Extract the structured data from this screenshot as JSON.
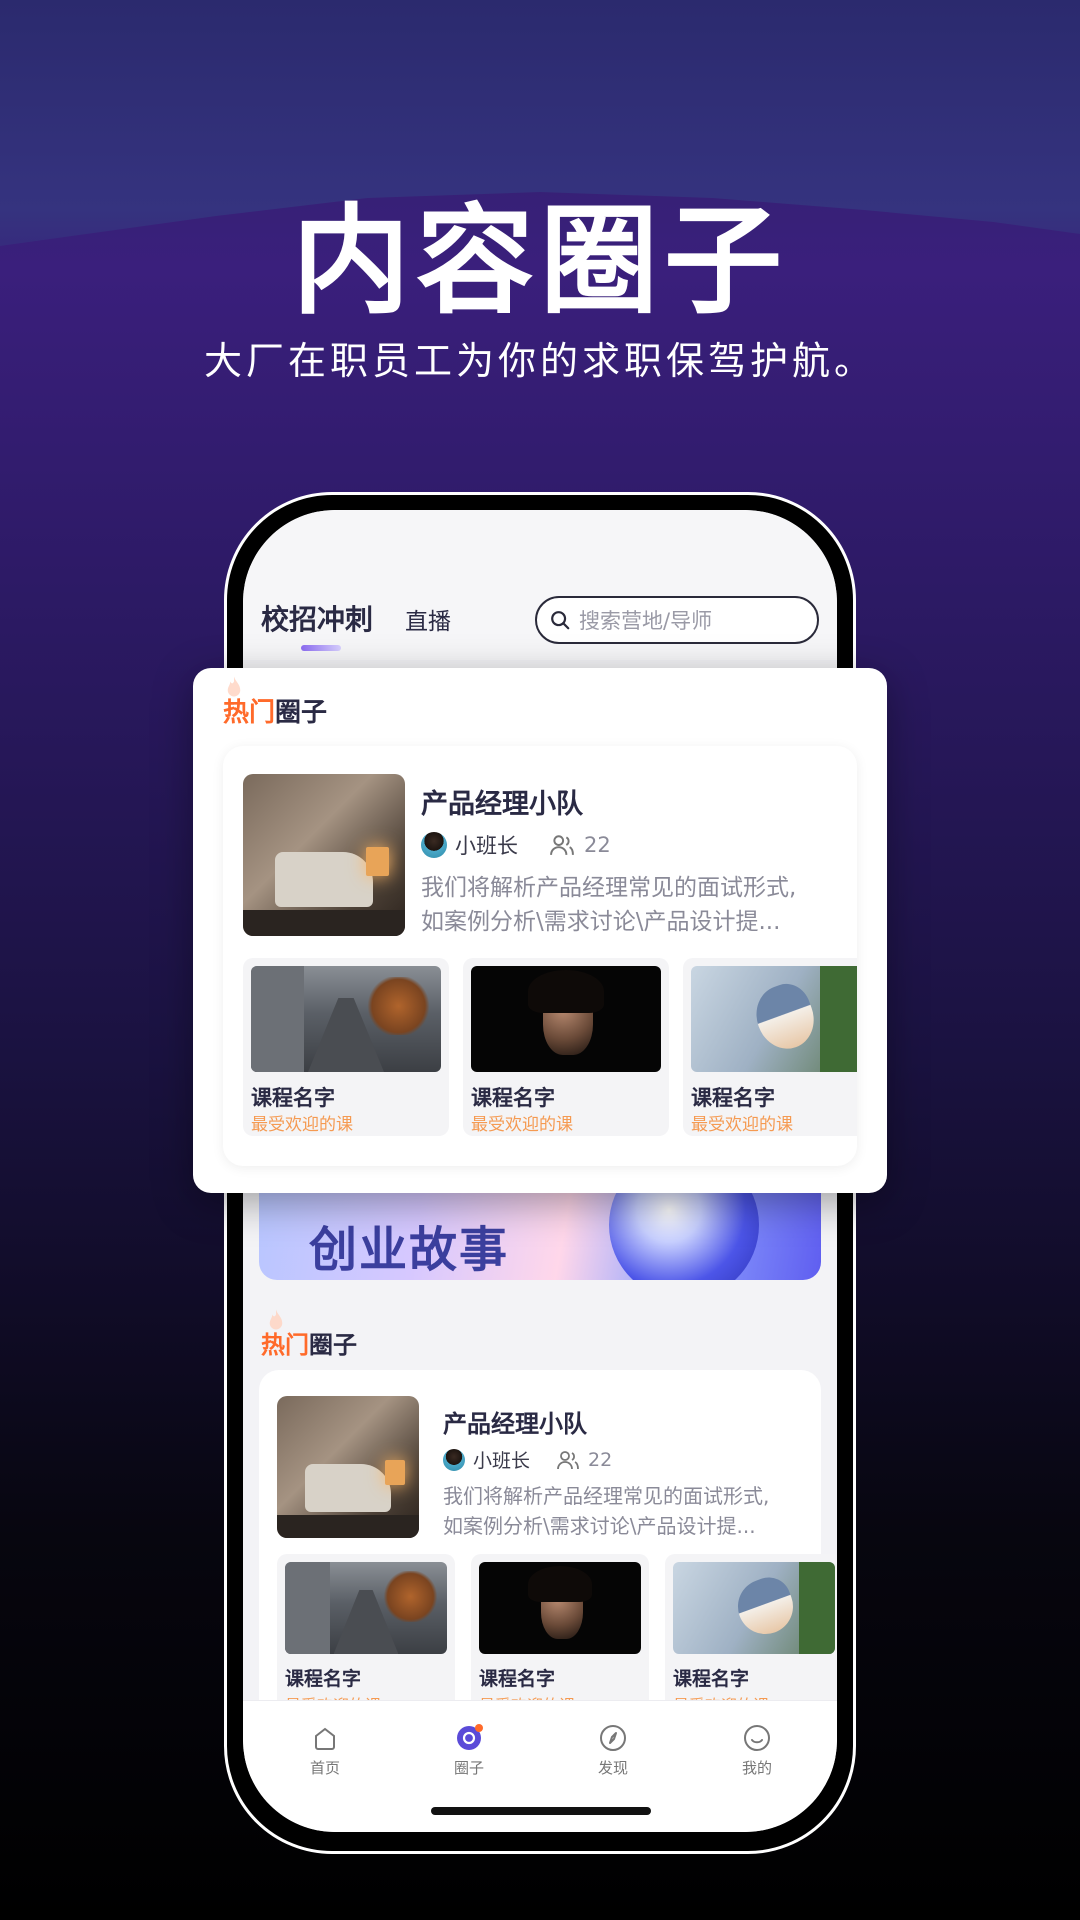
{
  "hero": {
    "title": "内容圈子",
    "subtitle": "大厂在职员工为你的求职保驾护航。"
  },
  "header": {
    "tab_active": "校招冲刺",
    "tab_live": "直播",
    "search_placeholder": "搜索营地/导师"
  },
  "banner": {
    "text": "创业故事"
  },
  "section": {
    "hot": "热门",
    "circle": "圈子"
  },
  "circle": {
    "name": "产品经理小队",
    "owner": "小班长",
    "members": "22",
    "desc_line1": "我们将解析产品经理常见的面试形式,",
    "desc_line2": "如案例分析\\需求讨论\\产品设计提..."
  },
  "courses": [
    {
      "name": "课程名字",
      "tag": "最受欢迎的课"
    },
    {
      "name": "课程名字",
      "tag": "最受欢迎的课"
    },
    {
      "name": "课程名字",
      "tag": "最受欢迎的课"
    }
  ],
  "nav": {
    "home": "首页",
    "circle": "圈子",
    "discover": "发现",
    "mine": "我的"
  },
  "colors": {
    "accent_hot": "#ff6a2a",
    "course_tag": "#f59a52",
    "nav_active": "#5b4bd8"
  }
}
